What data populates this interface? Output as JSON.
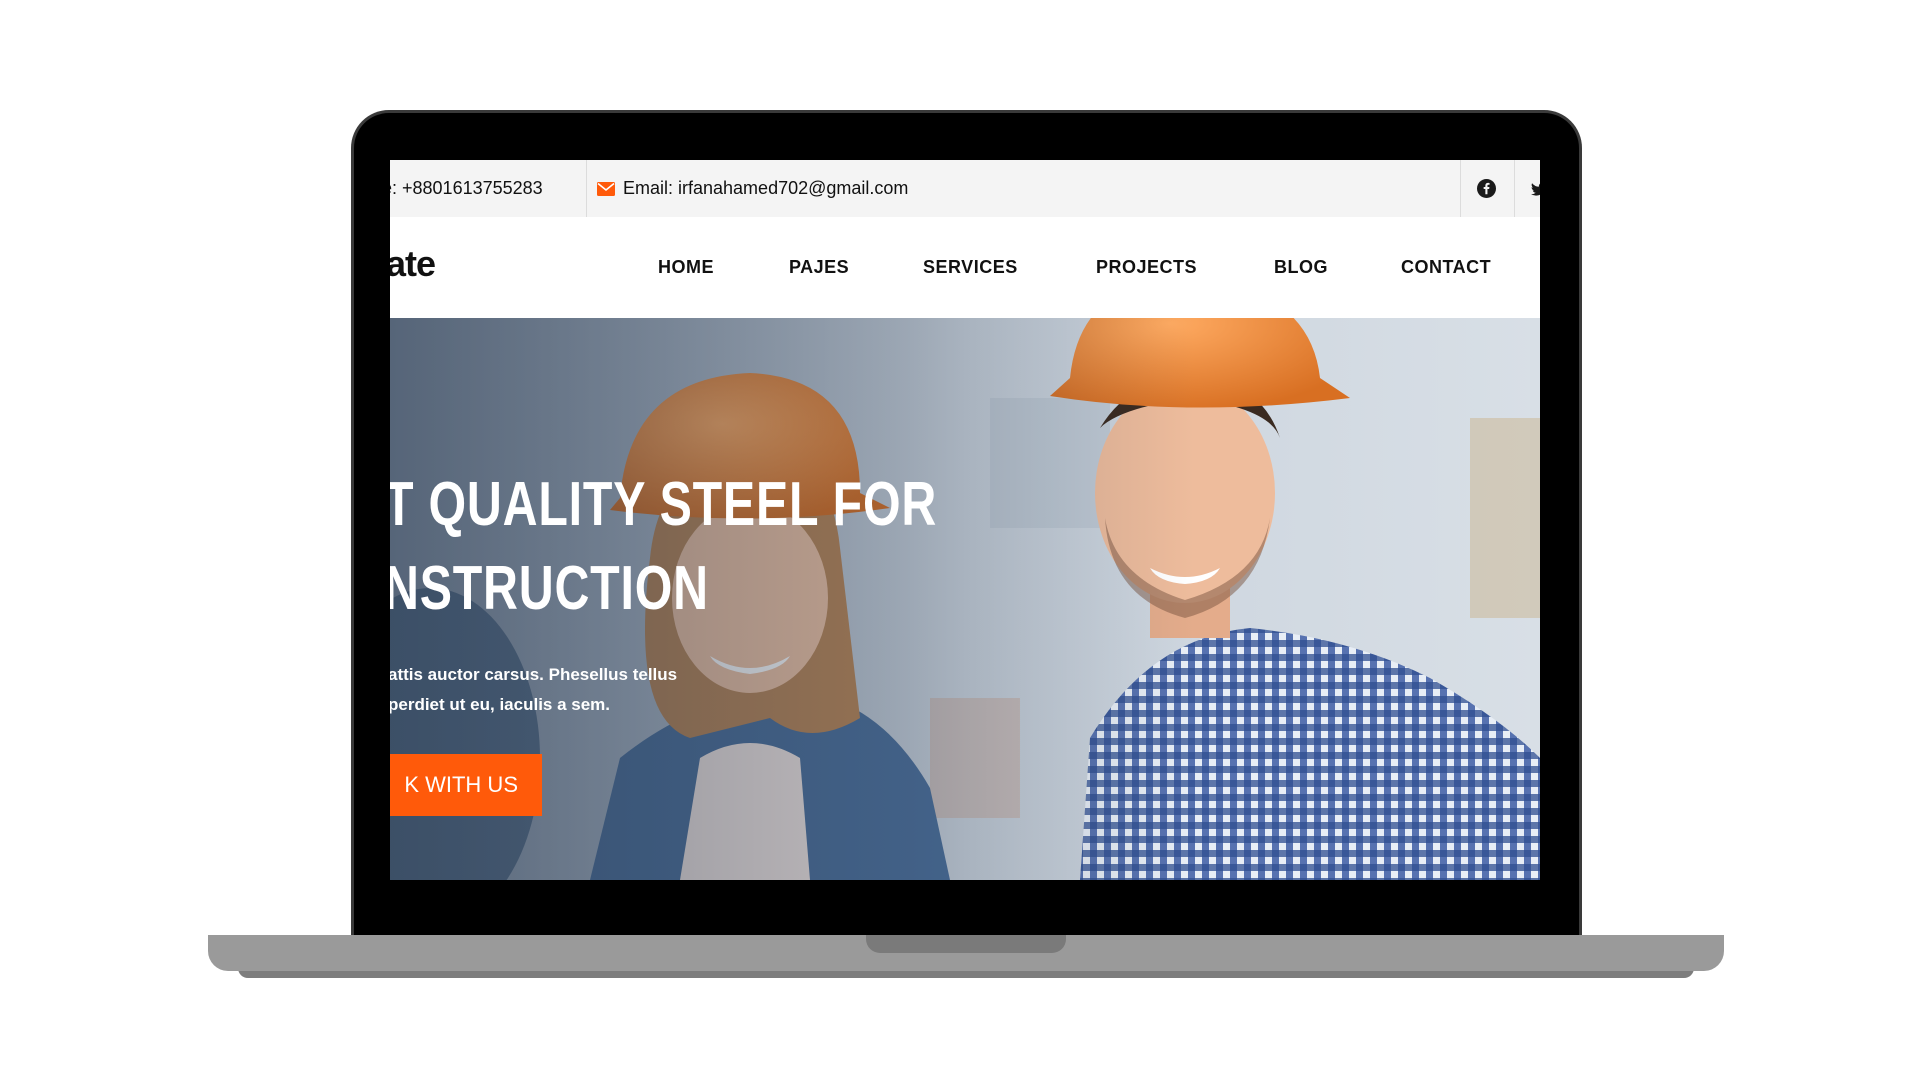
{
  "topbar": {
    "phone": "e: +8801613755283",
    "email": "Email: irfanahamed702@gmail.com"
  },
  "logo": "ate",
  "nav": [
    "HOME",
    "PAJES",
    "SERVICES",
    "PROJECTS",
    "BLOG",
    "CONTACT"
  ],
  "hero": {
    "headline_line1": "T QUALITY STEEL FOR",
    "headline_line2": "NSTRUCTION",
    "subtext_line1": "attis auctor carsus. Phesellus tellus",
    "subtext_line2": "perdiet ut eu, iaculis a sem.",
    "cta": "K WITH US"
  },
  "colors": {
    "accent": "#ff5a0a",
    "helmet": "#f08a3a",
    "shirt_check": "#3a5aa0"
  },
  "icons": [
    "mail-icon",
    "facebook-icon",
    "twitter-icon"
  ]
}
